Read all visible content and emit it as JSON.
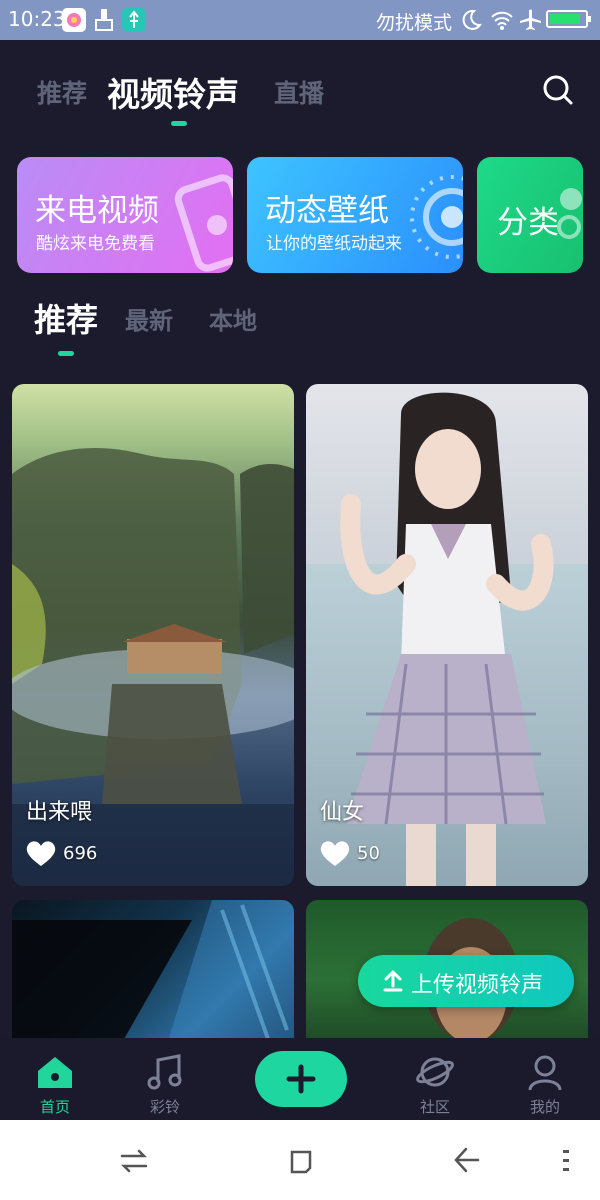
{
  "status_bar": {
    "time": "10:23",
    "dnd_label": "勿扰模式"
  },
  "top_tabs": [
    {
      "label": "推荐",
      "active": false
    },
    {
      "label": "视频铃声",
      "active": true
    },
    {
      "label": "直播",
      "active": false
    }
  ],
  "category_cards": [
    {
      "title": "来电视频",
      "subtitle": "酷炫来电免费看"
    },
    {
      "title": "动态壁纸",
      "subtitle": "让你的壁纸动起来"
    },
    {
      "title": "分类",
      "subtitle": ""
    }
  ],
  "sub_tabs": [
    {
      "label": "推荐",
      "active": true
    },
    {
      "label": "最新",
      "active": false
    },
    {
      "label": "本地",
      "active": false
    }
  ],
  "feed": [
    {
      "title": "出来喂",
      "likes": "696"
    },
    {
      "title": "仙女",
      "likes": "50"
    },
    {
      "title": "",
      "likes": ""
    },
    {
      "title": "",
      "likes": ""
    }
  ],
  "upload_button": {
    "label": "上传视频铃声"
  },
  "bottom_nav": [
    {
      "label": "首页",
      "icon": "home-icon",
      "active": true
    },
    {
      "label": "彩铃",
      "icon": "music-note-icon",
      "active": false
    },
    {
      "label": "",
      "icon": "plus-icon",
      "active": false
    },
    {
      "label": "社区",
      "icon": "planet-icon",
      "active": false
    },
    {
      "label": "我的",
      "icon": "user-icon",
      "active": false
    }
  ],
  "colors": {
    "accent": "#1ed6a0",
    "background": "#1c1b2d",
    "status_bar": "#8296c4"
  }
}
